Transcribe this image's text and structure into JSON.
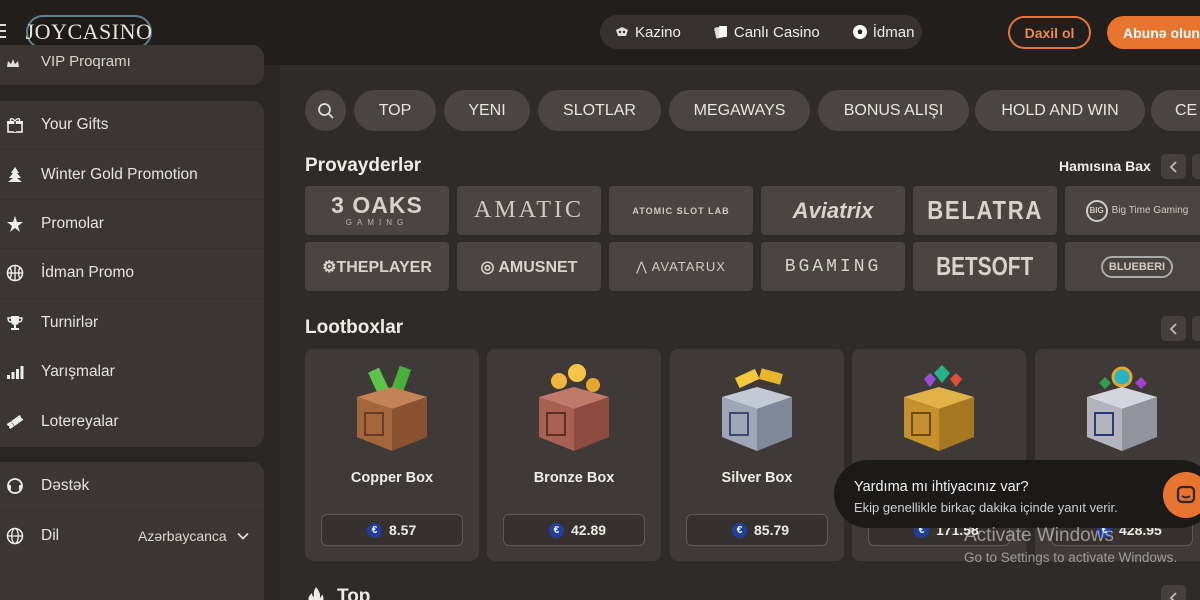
{
  "header": {
    "logo_text": "JOYCASINO",
    "nav": [
      {
        "label": "Kazino",
        "icon": "casino-icon"
      },
      {
        "label": "Canlı Casino",
        "icon": "cards-icon"
      },
      {
        "label": "İdman",
        "icon": "soccer-ball-icon"
      }
    ],
    "login_label": "Daxil ol",
    "register_label": "Abunə olun"
  },
  "sidebar": {
    "vip_label": "VIP Proqramı",
    "items": [
      {
        "label": "Your Gifts",
        "icon": "gift-icon"
      },
      {
        "label": "Winter Gold Promotion",
        "icon": "tree-icon"
      },
      {
        "label": "Promolar",
        "icon": "star-icon"
      },
      {
        "label": "İdman Promo",
        "icon": "basketball-icon"
      },
      {
        "label": "Turnirlər",
        "icon": "trophy-icon"
      },
      {
        "label": "Yarışmalar",
        "icon": "bars-icon"
      },
      {
        "label": "Lotereyalar",
        "icon": "ticket-icon"
      }
    ],
    "support_label": "Dəstək",
    "language_label": "Dil",
    "language_value": "Azərbaycanca"
  },
  "categories": [
    "TOP",
    "YENI",
    "SLOTLAR",
    "MEGAWAYS",
    "BONUS ALIŞI",
    "HOLD AND WIN",
    "CE"
  ],
  "providers": {
    "title": "Provayderlər",
    "see_all": "Hamısına Bax",
    "items": [
      "3 OAKS GAMING",
      "AMATIC",
      "ATOMIC SLOT LAB",
      "Aviatrix",
      "BELATRA",
      "Big Time Gaming",
      "THEPLAYER.COM",
      "AMUSNET",
      "AVATARUX",
      "BGAMING",
      "BETSOFT",
      "BLUEBERRY"
    ]
  },
  "lootboxes": {
    "title": "Lootboxlar",
    "items": [
      {
        "name": "Copper Box",
        "price": "8.57",
        "color": "#b87a4b"
      },
      {
        "name": "Bronze Box",
        "price": "42.89",
        "color": "#b66a5a"
      },
      {
        "name": "Silver Box",
        "price": "85.79",
        "color": "#9aa3b3"
      },
      {
        "name": "",
        "price": "171.58",
        "color": "#d6a43a"
      },
      {
        "name": "",
        "price": "428.95",
        "color": "#b9bcc4"
      }
    ]
  },
  "next_section_title": "Top",
  "chat": {
    "title": "Yardıma mı ihtiyacınız var?",
    "subtitle": "Ekip genellikle birkaç dakika içinde yanıt verir."
  },
  "watermark": {
    "line1": "Activate Windows",
    "line2": "Go to Settings to activate Windows."
  },
  "colors": {
    "accent": "#e8752f",
    "bg": "#2f2b29",
    "header": "#211e1c"
  }
}
